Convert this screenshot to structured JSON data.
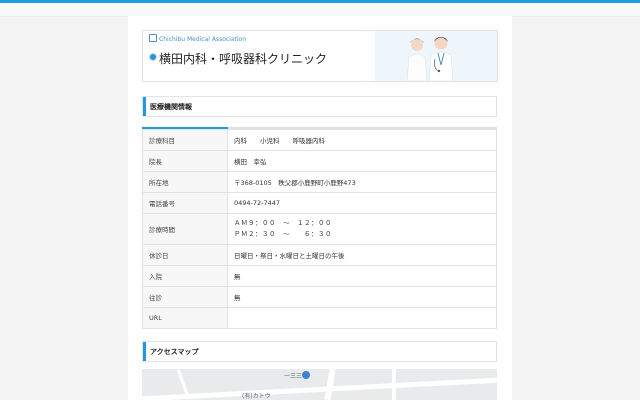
{
  "header": {
    "association": "Chichibu Medical Association",
    "clinic_name": "横田内科・呼吸器科クリニック"
  },
  "sections": {
    "info_title": "医療機関情報",
    "map_title": "アクセスマップ"
  },
  "info_rows": [
    {
      "label": "診療科目",
      "value": "内科　　小児科　　呼吸器内科"
    },
    {
      "label": "院長",
      "value": "横田　幸弘"
    },
    {
      "label": "所在地",
      "value": "〒368-0105　秩父郡小鹿野町小鹿野473"
    },
    {
      "label": "電話番号",
      "value": "0494-72-7447"
    },
    {
      "label": "診療時間",
      "value_lines": [
        "ＡＭ９：００　～　１２：００",
        "ＰＭ２：３０　～　　６：３０"
      ]
    },
    {
      "label": "休診日",
      "value": "日曜日・祭日・水曜日と土曜日の午後"
    },
    {
      "label": "入院",
      "value": "無"
    },
    {
      "label": "往診",
      "value": "無"
    },
    {
      "label": "URL",
      "value": ""
    }
  ],
  "map": {
    "label_top": "一三三",
    "label_bottom": "(有)カトウ"
  },
  "colors": {
    "accent": "#1e9be0",
    "border": "#e2e2e2"
  }
}
